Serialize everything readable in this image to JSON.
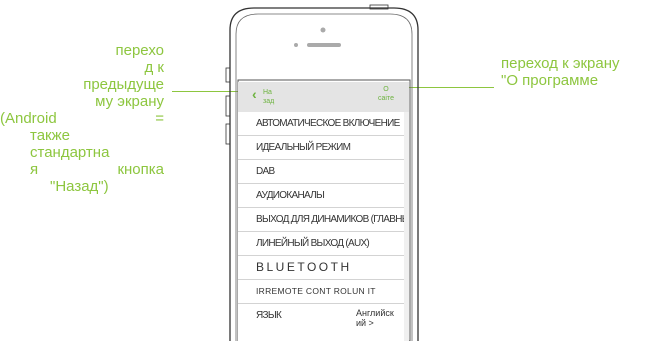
{
  "annotations": {
    "left_lines": [
      "перехо",
      "д к",
      "предыдуще",
      "му экрану"
    ],
    "left_android": "(Android",
    "left_eq": "=",
    "left_also": "также",
    "left_standard": "стандартна",
    "left_ya": "я",
    "left_button": "кнопка",
    "left_back": "\"Назад\")",
    "right_lines": [
      "переход к экрану",
      "\"О программе"
    ],
    "color": "#8dc63f"
  },
  "navbar": {
    "back_label": "Назад",
    "about_label_1": "О",
    "about_label_2": "саіте"
  },
  "menu": [
    "АВТОМАТИЧЕСКОЕ ВКЛЮЧЕНИЕ",
    "ИДЕАЛЬНЫЙ РЕЖИМ",
    "DAB",
    "АУДИОКАНАЛЫ",
    "ВЫХОД ДЛЯ ДИНАМИКОВ (ГЛАВНЫЙ)",
    "ЛИНЕЙНЫЙ ВЫХОД (AUX)",
    "BLUETOOTH",
    "IRREMOTE CONT ROLUN IT",
    "ЯЗЫК"
  ],
  "language_value": "Английск ий >"
}
